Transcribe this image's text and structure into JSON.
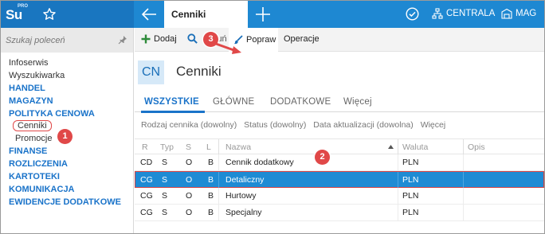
{
  "logo": {
    "text": "Su",
    "pro": "PRO"
  },
  "topbar": {
    "active_tab": "Cenniki",
    "centrala": "CENTRALA",
    "mag": "MAG"
  },
  "sidebar": {
    "search_placeholder": "Szukaj poleceń",
    "items": [
      {
        "label": "Infoserwis",
        "style": "plain"
      },
      {
        "label": "Wyszukiwarka",
        "style": "plain"
      },
      {
        "label": "HANDEL",
        "style": "bold"
      },
      {
        "label": "MAGAZYN",
        "style": "bold"
      },
      {
        "label": "POLITYKA CENOWA",
        "style": "bold"
      },
      {
        "label": "Cenniki",
        "style": "sub-selected"
      },
      {
        "label": "Promocje",
        "style": "sub"
      },
      {
        "label": "FINANSE",
        "style": "bold"
      },
      {
        "label": "ROZLICZENIA",
        "style": "bold"
      },
      {
        "label": "KARTOTEKI",
        "style": "bold"
      },
      {
        "label": "KOMUNIKACJA",
        "style": "bold"
      },
      {
        "label": "EWIDENCJE DODATKOWE",
        "style": "bold"
      }
    ]
  },
  "toolbar": {
    "add": "Dodaj",
    "delete": "Usuń",
    "edit": "Popraw",
    "operations": "Operacje"
  },
  "page": {
    "badge": "CN",
    "title": "Cenniki"
  },
  "tabs": [
    "WSZYSTKIE",
    "GŁÓWNE",
    "DODATKOWE",
    "Więcej"
  ],
  "filters": [
    "Rodzaj cennika (dowolny)",
    "Status (dowolny)",
    "Data aktualizacji (dowolna)",
    "Więcej"
  ],
  "grid": {
    "columns": [
      "R",
      "Typ",
      "S",
      "L",
      "Nazwa",
      "Waluta",
      "Opis"
    ],
    "rows": [
      [
        "CD",
        "S",
        "O",
        "B",
        "Cennik dodatkowy",
        "PLN",
        ""
      ],
      [
        "CG",
        "S",
        "O",
        "B",
        "Detaliczny",
        "PLN",
        ""
      ],
      [
        "CG",
        "S",
        "O",
        "B",
        "Hurtowy",
        "PLN",
        ""
      ],
      [
        "CG",
        "S",
        "O",
        "B",
        "Specjalny",
        "PLN",
        ""
      ]
    ],
    "selected_row": 1
  },
  "annotations": [
    "1",
    "2",
    "3"
  ],
  "colors": {
    "topbar": "#1e88d2",
    "accent": "#1a73c9",
    "selection": "#1e8bd4",
    "annotation": "#e04848"
  }
}
